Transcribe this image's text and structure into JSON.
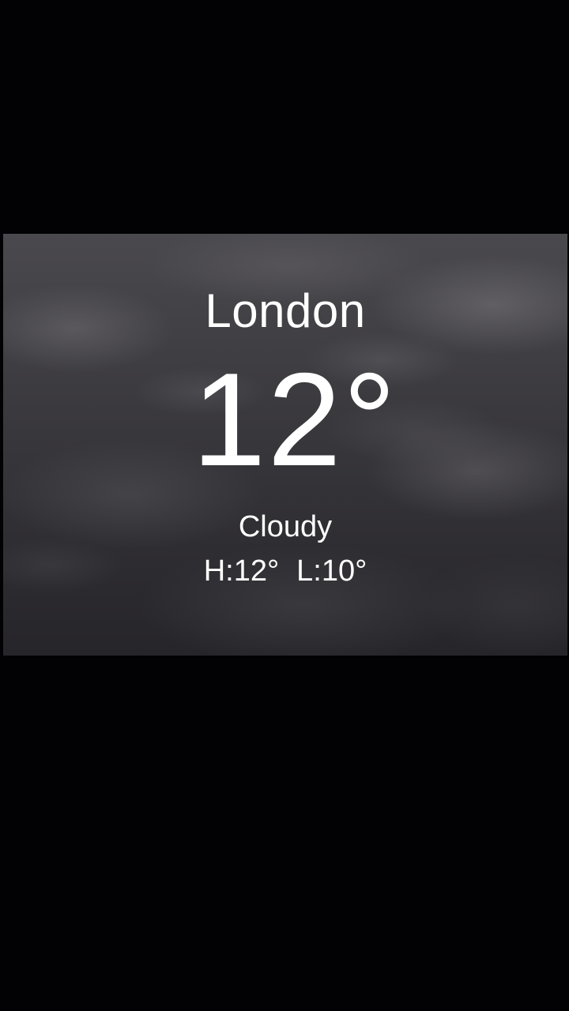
{
  "weather": {
    "city": "London",
    "temperature": "12°",
    "condition": "Cloudy",
    "high": "H:12°",
    "low": "L:10°"
  },
  "colors": {
    "background": "#000000",
    "text": "#ffffff",
    "card": "#3b3a3e"
  }
}
